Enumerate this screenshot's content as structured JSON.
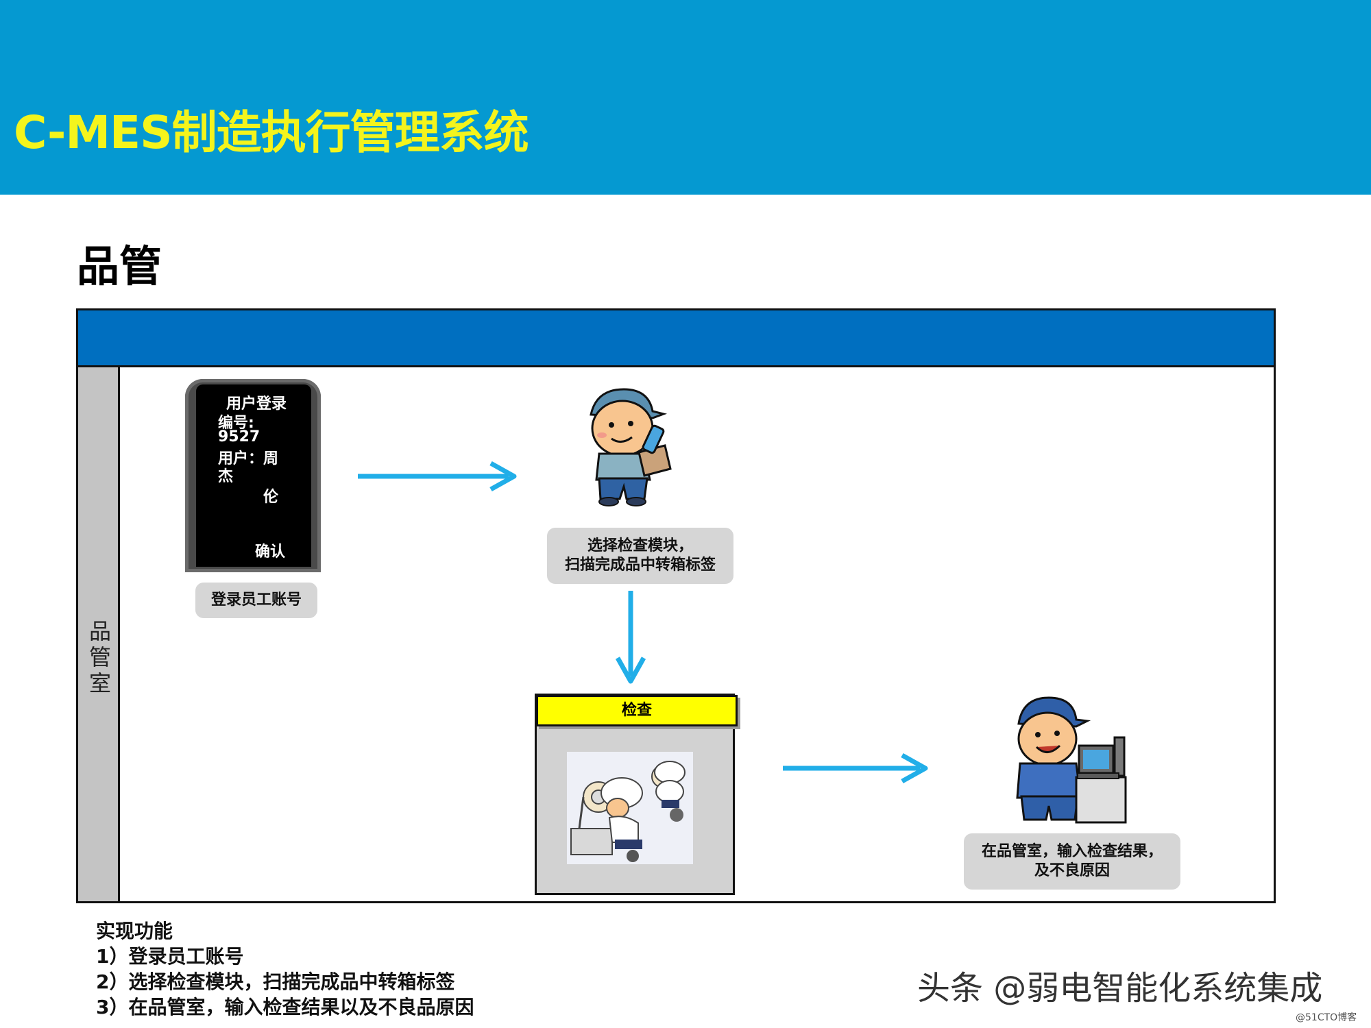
{
  "header": {
    "title": "C-MES制造执行管理系统",
    "bg_color": "#0599d1",
    "title_color": "#f4f41c"
  },
  "section": {
    "title": "品管"
  },
  "lane": {
    "label_chars": [
      "品",
      "管",
      "室"
    ],
    "header_color": "#006fc0"
  },
  "phone": {
    "line1": "用户登录",
    "line2": "编号:",
    "line3": "9527",
    "line4": "用户：周",
    "line5": "杰",
    "line6": "伦",
    "confirm": "确认"
  },
  "steps": {
    "login": "登录员工账号",
    "select_line1": "选择检查模块，",
    "select_line2": "扫描完成品中转箱标签",
    "inspect_title": "检查",
    "result_line1": "在品管室，输入检查结果，",
    "result_line2": "及不良原因"
  },
  "functions": {
    "heading": "实现功能",
    "items": [
      "1）登录员工账号",
      "2）选择检查模块，扫描完成品中转箱标签",
      "3）在品管室，输入检查结果以及不良品原因"
    ]
  },
  "watermark": "头条 @弱电智能化系统集成",
  "credit": "@51CTO博客",
  "icons": [
    "phone-icon",
    "worker-scanner-icon",
    "inspection-workers-icon",
    "worker-computer-icon",
    "arrow-right-icon",
    "arrow-down-icon"
  ],
  "colors": {
    "arrow": "#21aee8",
    "inspect_header": "#ffff00",
    "caption_bg": "#d6d6d6"
  }
}
